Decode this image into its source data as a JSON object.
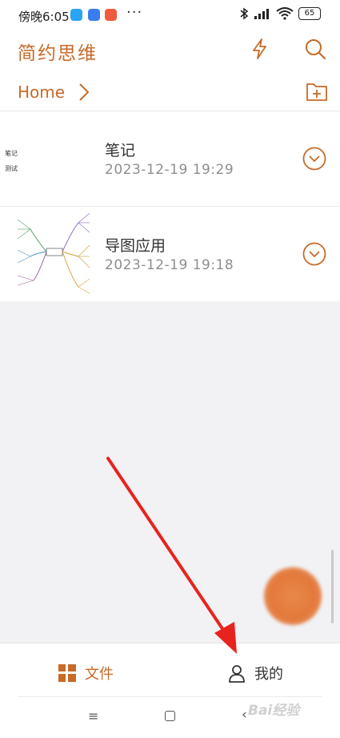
{
  "status_bar": {
    "time": "傍晚6:05",
    "dots": "···",
    "battery": "65",
    "colors": {
      "app1": "#2aa4f4",
      "app2": "#3a7df0",
      "app3": "#f05a3c"
    }
  },
  "app_bar": {
    "title": "简约思维",
    "icons": [
      "flash-icon",
      "search-icon"
    ],
    "accent_color": "#c86a28"
  },
  "breadcrumb": {
    "home": "Home",
    "icon": "new-folder-icon"
  },
  "files": [
    {
      "title": "笔记",
      "date": "2023-12-19 19:29",
      "thumb_lines": [
        "笔记",
        "测试"
      ]
    },
    {
      "title": "导图应用",
      "date": "2023-12-19 19:18"
    }
  ],
  "fab": {
    "color": "#e3793b"
  },
  "tabs": [
    {
      "label": "文件",
      "icon": "grid-icon",
      "active": true
    },
    {
      "label": "我的",
      "icon": "person-icon",
      "active": false
    }
  ],
  "system_nav": {
    "menu": "≡",
    "back": "‹"
  },
  "watermark": "Bai经验"
}
